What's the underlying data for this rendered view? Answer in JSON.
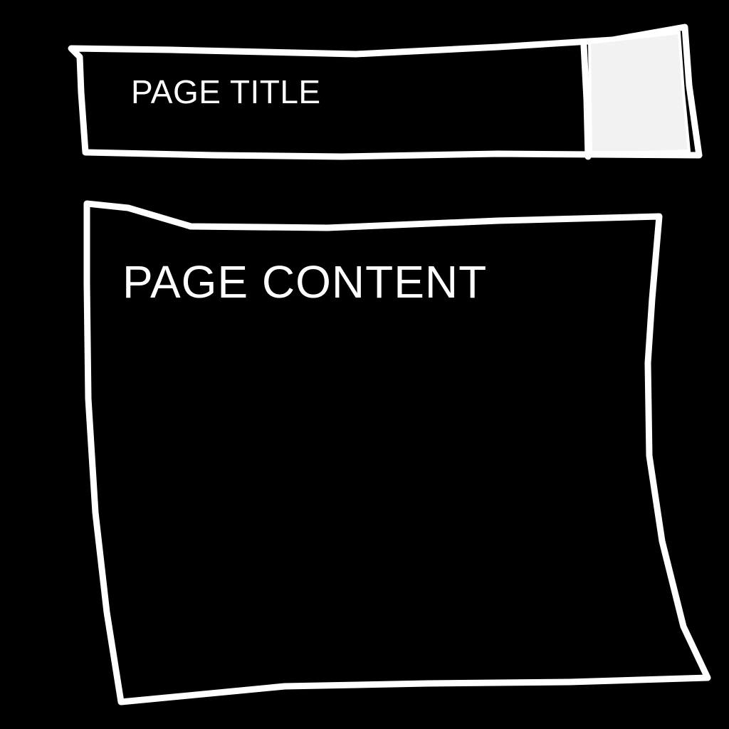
{
  "header": {
    "title": "PAGE TITLE",
    "action_icon": "blank-square-icon"
  },
  "main": {
    "content_label": "PAGE CONTENT"
  },
  "colors": {
    "background": "#000000",
    "stroke": "#ffffff",
    "header_box_fill": "#f2f2f2"
  }
}
